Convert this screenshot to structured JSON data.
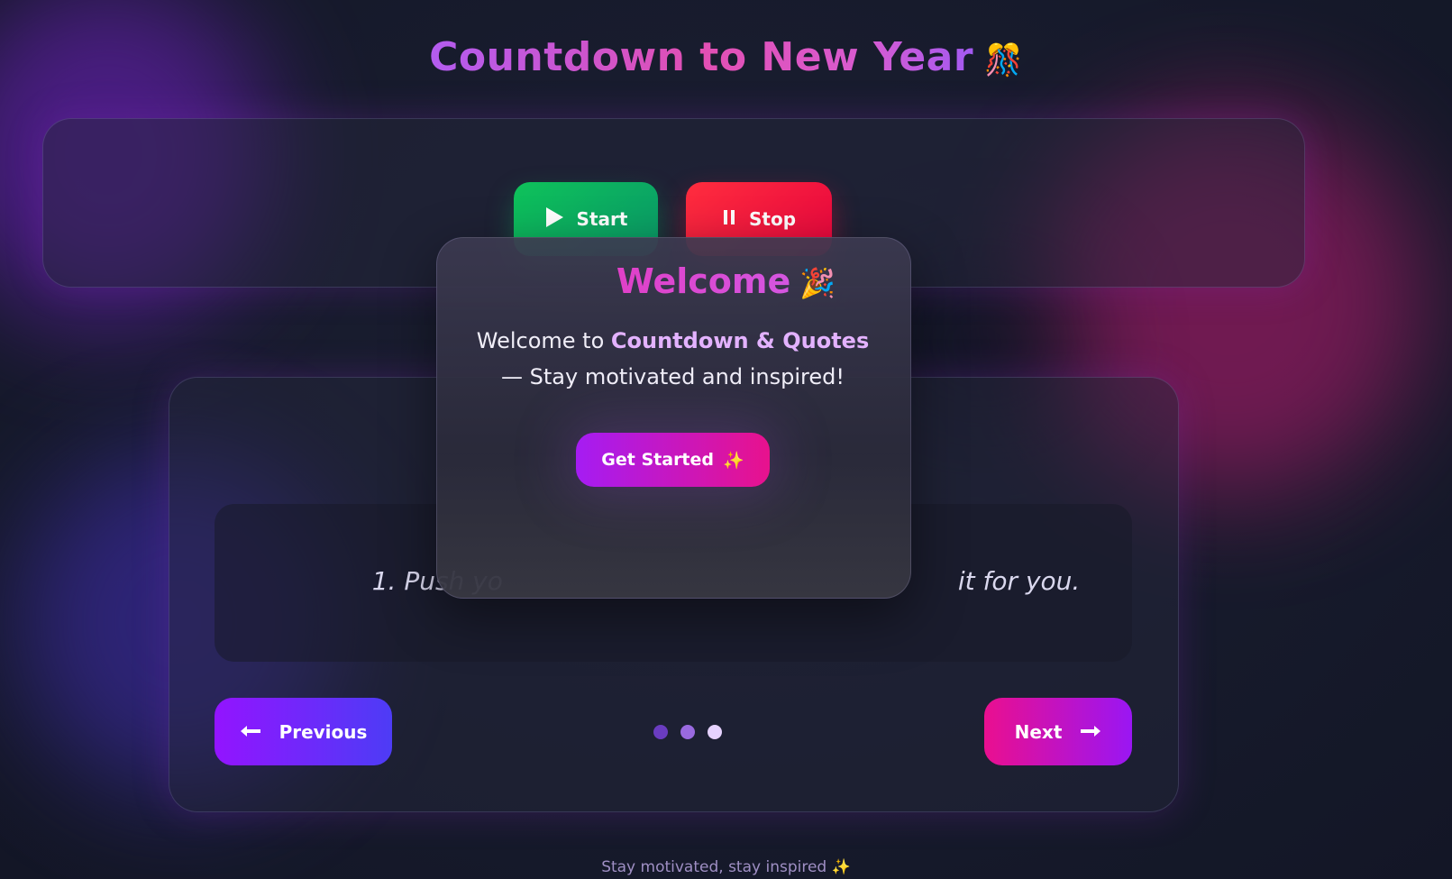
{
  "header": {
    "title": "Countdown to New Year",
    "title_emoji": "🎊"
  },
  "controls": {
    "start_label": "Start",
    "stop_label": "Stop",
    "start_icon": "play-icon",
    "stop_icon": "pause-icon"
  },
  "quote": {
    "visible_left": "1. Push yo",
    "visible_right": "it for you."
  },
  "navigation": {
    "previous_label": "Previous",
    "next_label": "Next",
    "dots": 3,
    "active_dot": 3
  },
  "modal": {
    "title": "Welcome",
    "title_emoji": "🎉",
    "body_prefix": "Welcome to ",
    "body_highlight": "Countdown & Quotes",
    "body_suffix": "— Stay motivated and inspired!",
    "button_label": "Get Started",
    "button_emoji": "✨"
  },
  "footer": {
    "text": "Stay motivated, stay inspired ✨"
  },
  "colors": {
    "background": "#171a2b",
    "start": "#0ec25a",
    "stop": "#ff2d3e",
    "accent_purple": "#9314ff",
    "accent_pink": "#ea0f8f"
  }
}
